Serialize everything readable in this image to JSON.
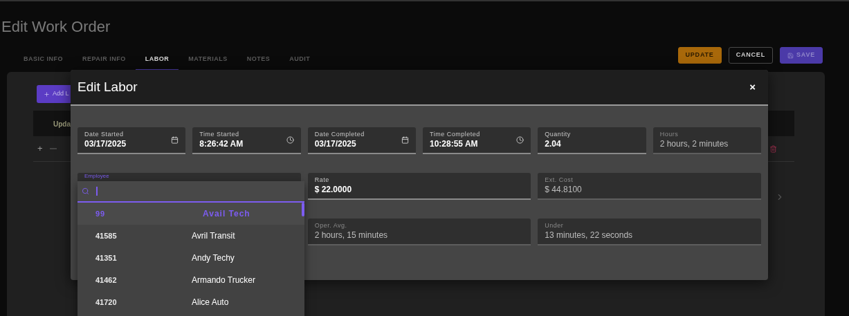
{
  "page": {
    "title": "Edit Work Order",
    "tabs": [
      {
        "label": "BASIC INFO",
        "selected": false
      },
      {
        "label": "REPAIR INFO",
        "selected": false
      },
      {
        "label": "LABOR",
        "selected": true
      },
      {
        "label": "MATERIALS",
        "selected": false
      },
      {
        "label": "NOTES",
        "selected": false
      },
      {
        "label": "AUDIT",
        "selected": false
      }
    ],
    "buttons": [
      {
        "label": "UPDATE",
        "kind": "warning"
      },
      {
        "label": "CANCEL",
        "kind": "outline"
      },
      {
        "label": "SAVE",
        "kind": "primary"
      }
    ],
    "background": {
      "add_button": "Add L",
      "column_header": "Upda",
      "row_expand": "+"
    }
  },
  "dialog": {
    "title": "Edit Labor",
    "close": "×",
    "rows": [
      [
        {
          "label": "Date Started",
          "value": "03/17/2025",
          "kind": "date",
          "disabled": false
        },
        {
          "label": "Time Started",
          "value": "8:26:42 AM",
          "kind": "time",
          "disabled": false
        },
        {
          "label": "Date Completed",
          "value": "03/17/2025",
          "kind": "date",
          "disabled": false
        },
        {
          "label": "Time Completed",
          "value": "10:28:55 AM",
          "kind": "time",
          "disabled": false
        },
        {
          "label": "Quantity",
          "value": "2.04",
          "disabled": false
        },
        {
          "label": "Hours",
          "value": "2 hours, 2 minutes",
          "disabled": true
        }
      ],
      [
        {
          "label": "Rate",
          "value": "$ 22.0000",
          "disabled": false
        },
        {
          "label": "Ext. Cost",
          "value": "$ 44.8100",
          "disabled": true
        }
      ],
      [
        {
          "label": "Oper. Avg.",
          "value": "2 hours, 15 minutes",
          "disabled": true
        },
        {
          "label": "Under",
          "value": "13 minutes, 22 seconds",
          "disabled": true
        }
      ]
    ],
    "employee": {
      "label": "Employee",
      "options": [
        {
          "code": "99",
          "name": "Avail Tech",
          "selected": true
        },
        {
          "code": "41585",
          "name": "Avril Transit",
          "selected": false
        },
        {
          "code": "41351",
          "name": "Andy Techy",
          "selected": false
        },
        {
          "code": "41462",
          "name": "Armando Trucker",
          "selected": false
        },
        {
          "code": "41720",
          "name": "Alice Auto",
          "selected": false
        }
      ]
    }
  }
}
